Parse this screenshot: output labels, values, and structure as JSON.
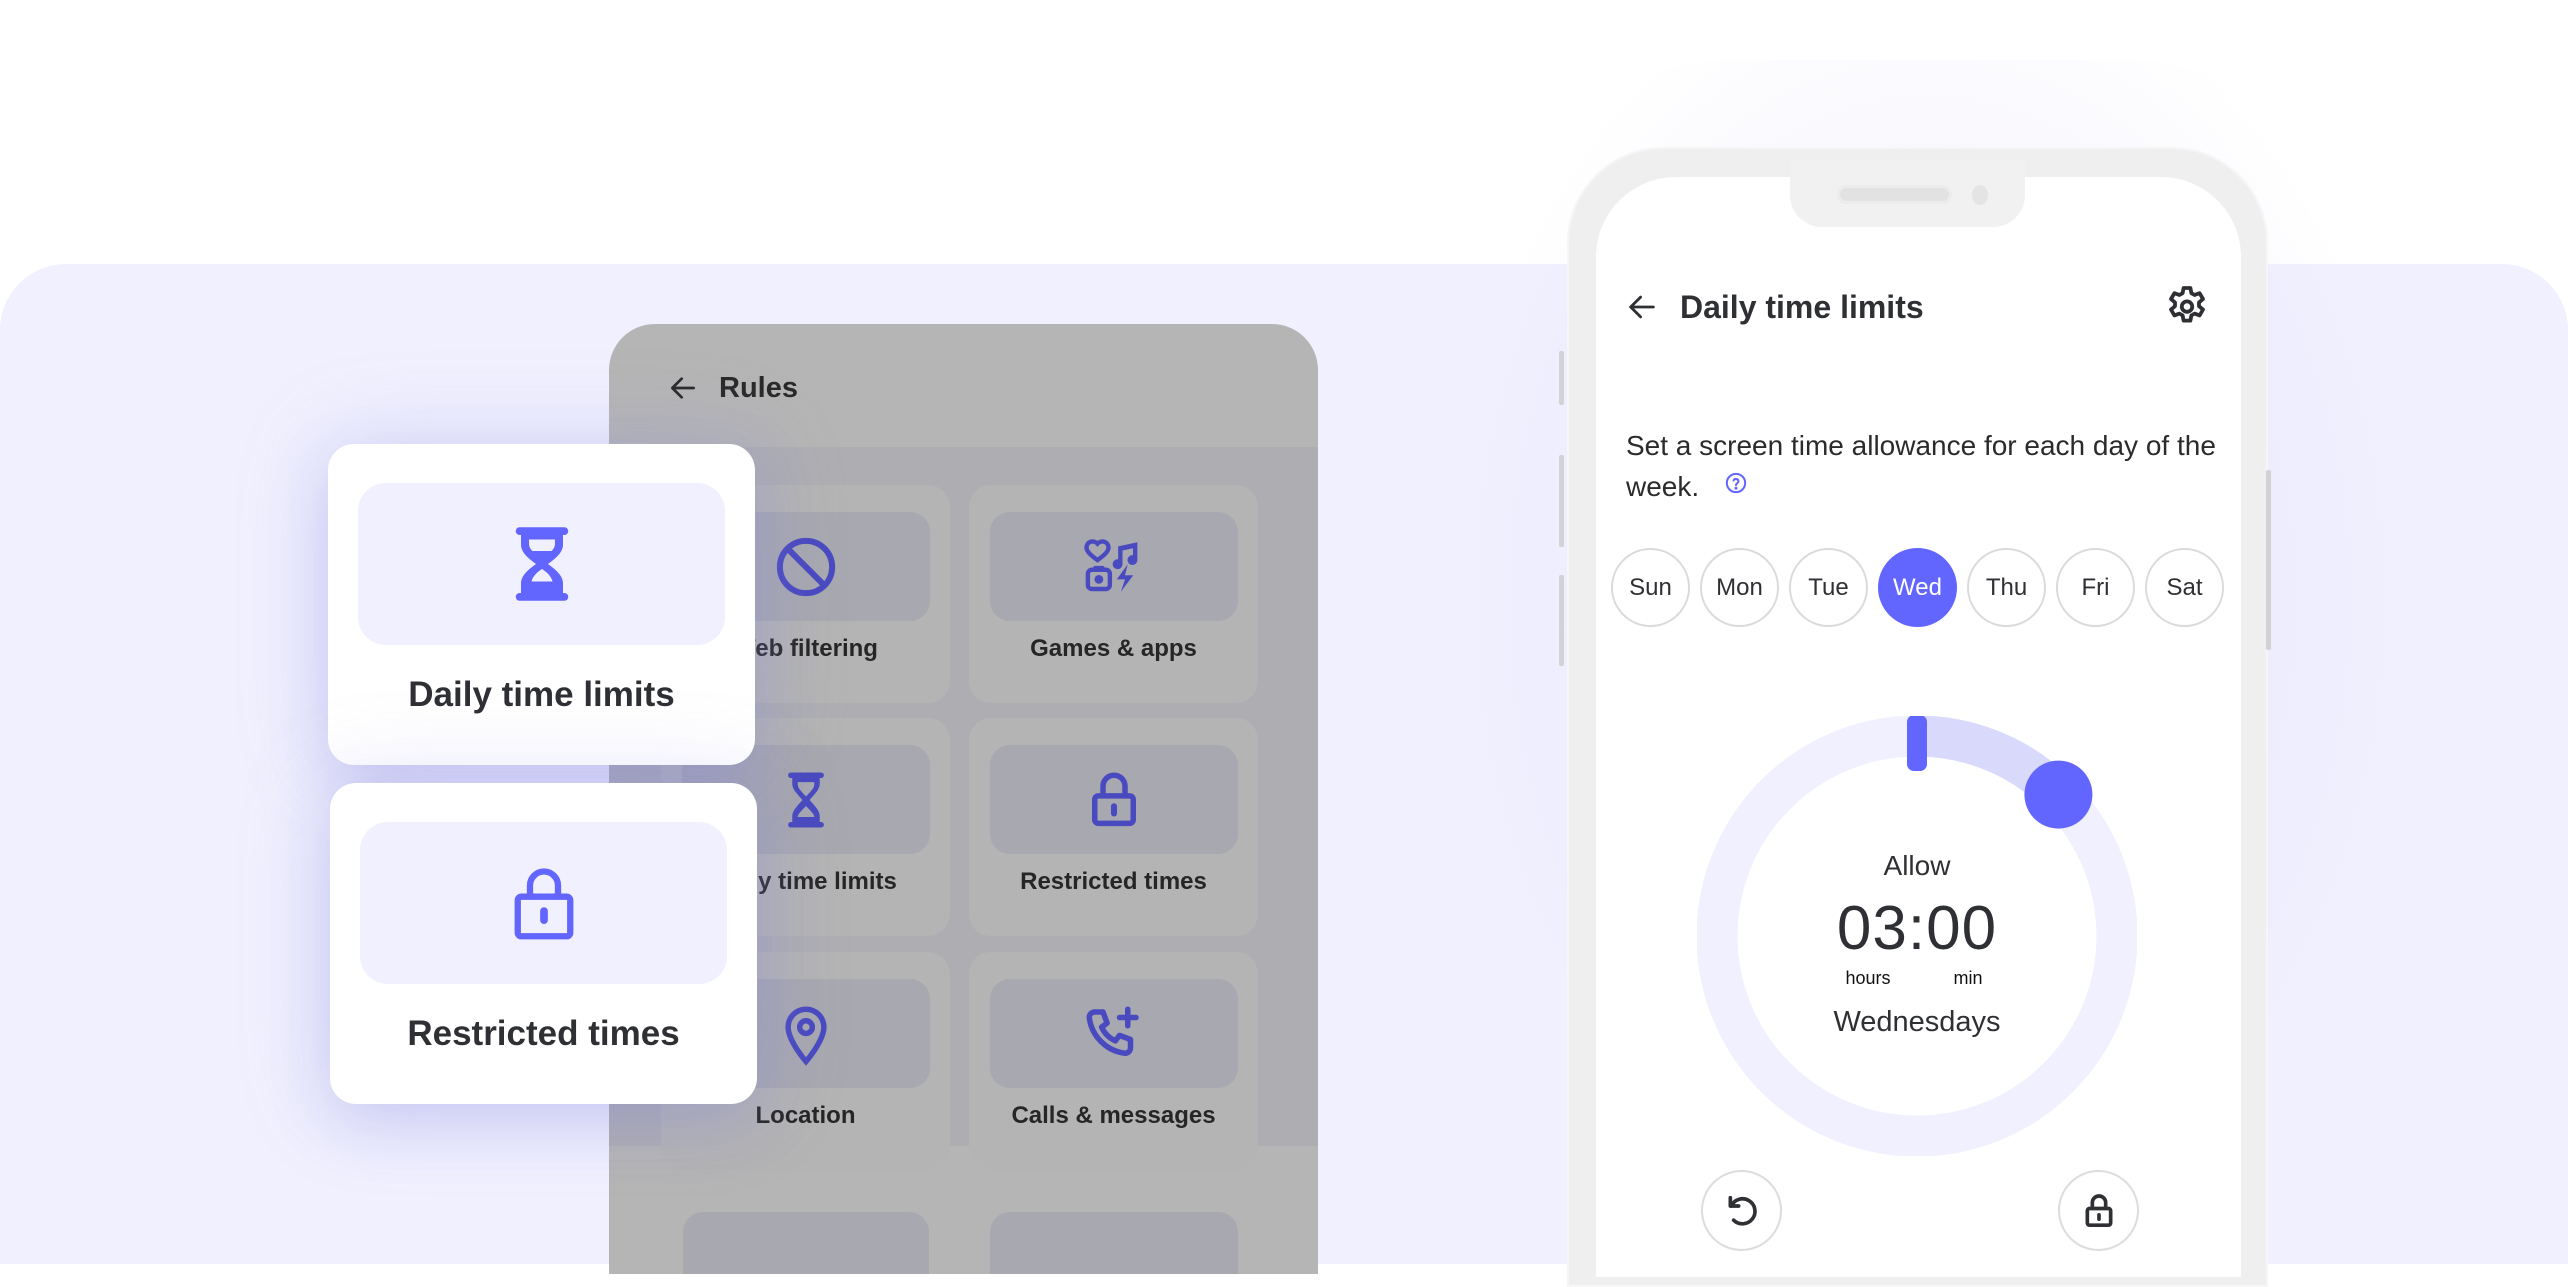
{
  "colors": {
    "accent": "#6265FE",
    "accent_light": "#D9D9FC",
    "track": "#F0F0FE",
    "dimmed_icon": "#4A4AC0",
    "text": "#2F3034"
  },
  "rules_panel": {
    "title": "Rules",
    "back_icon": "arrow-left-icon",
    "items": [
      {
        "label": "Web filtering",
        "icon": "block-icon"
      },
      {
        "label": "Games & apps",
        "icon": "games-apps-icon"
      },
      {
        "label": "Daily time limits",
        "icon": "hourglass-icon"
      },
      {
        "label": "Restricted times",
        "icon": "lock-icon"
      },
      {
        "label": "Location",
        "icon": "location-pin-icon"
      },
      {
        "label": "Calls & messages",
        "icon": "phone-plus-icon"
      }
    ]
  },
  "feature_cards": [
    {
      "label": "Daily time limits",
      "icon": "hourglass-icon"
    },
    {
      "label": "Restricted times",
      "icon": "lock-icon"
    }
  ],
  "phone_screen": {
    "title": "Daily time limits",
    "back_icon": "arrow-left-icon",
    "settings_icon": "gear-icon",
    "intro": "Set a screen time allowance for each day of the week.",
    "help_icon": "help-circle-icon",
    "days": [
      {
        "label": "Sun",
        "selected": false
      },
      {
        "label": "Mon",
        "selected": false
      },
      {
        "label": "Tue",
        "selected": false
      },
      {
        "label": "Wed",
        "selected": true
      },
      {
        "label": "Thu",
        "selected": false
      },
      {
        "label": "Fri",
        "selected": false
      },
      {
        "label": "Sat",
        "selected": false
      }
    ],
    "dial": {
      "label": "Allow",
      "time": "03:00",
      "hours_unit": "hours",
      "minutes_unit": "min",
      "day_label": "Wednesdays",
      "allowed_hours": 3,
      "max_hours": 24
    },
    "actions": [
      {
        "name": "reset",
        "icon": "undo-icon"
      },
      {
        "name": "lock",
        "icon": "lock-icon"
      }
    ]
  }
}
